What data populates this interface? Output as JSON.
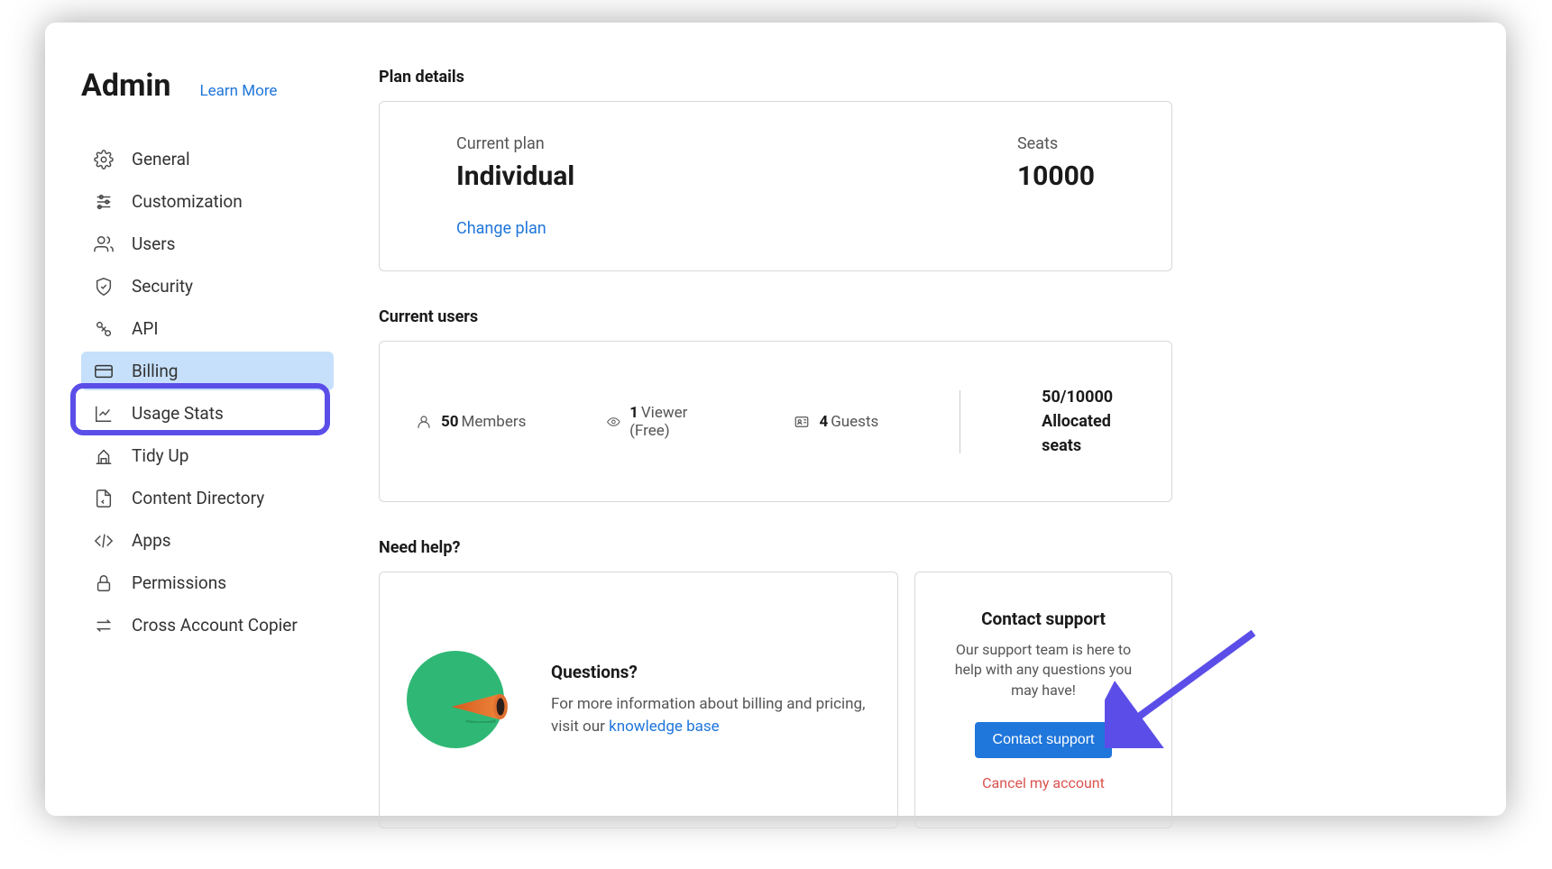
{
  "sidebar": {
    "title": "Admin",
    "learn_more": "Learn More",
    "items": [
      {
        "label": "General"
      },
      {
        "label": "Customization"
      },
      {
        "label": "Users"
      },
      {
        "label": "Security"
      },
      {
        "label": "API"
      },
      {
        "label": "Billing"
      },
      {
        "label": "Usage Stats"
      },
      {
        "label": "Tidy Up"
      },
      {
        "label": "Content Directory"
      },
      {
        "label": "Apps"
      },
      {
        "label": "Permissions"
      },
      {
        "label": "Cross Account Copier"
      }
    ]
  },
  "plan": {
    "section_title": "Plan details",
    "current_plan_label": "Current plan",
    "current_plan_value": "Individual",
    "seats_label": "Seats",
    "seats_value": "10000",
    "change_plan": "Change plan"
  },
  "users": {
    "section_title": "Current users",
    "members_count": "50",
    "members_label": "Members",
    "viewers_count": "1",
    "viewers_label": "Viewer (Free)",
    "guests_count": "4",
    "guests_label": "Guests",
    "allocated_value": "50/10000",
    "allocated_label": "Allocated seats"
  },
  "help": {
    "section_title": "Need help?",
    "questions_title": "Questions?",
    "questions_body_prefix": "For more information about billing and pricing, visit our ",
    "questions_link": "knowledge base",
    "support_title": "Contact support",
    "support_body": "Our support team is here to help with any questions you may have!",
    "contact_button": "Contact support",
    "cancel_link": "Cancel my account"
  }
}
